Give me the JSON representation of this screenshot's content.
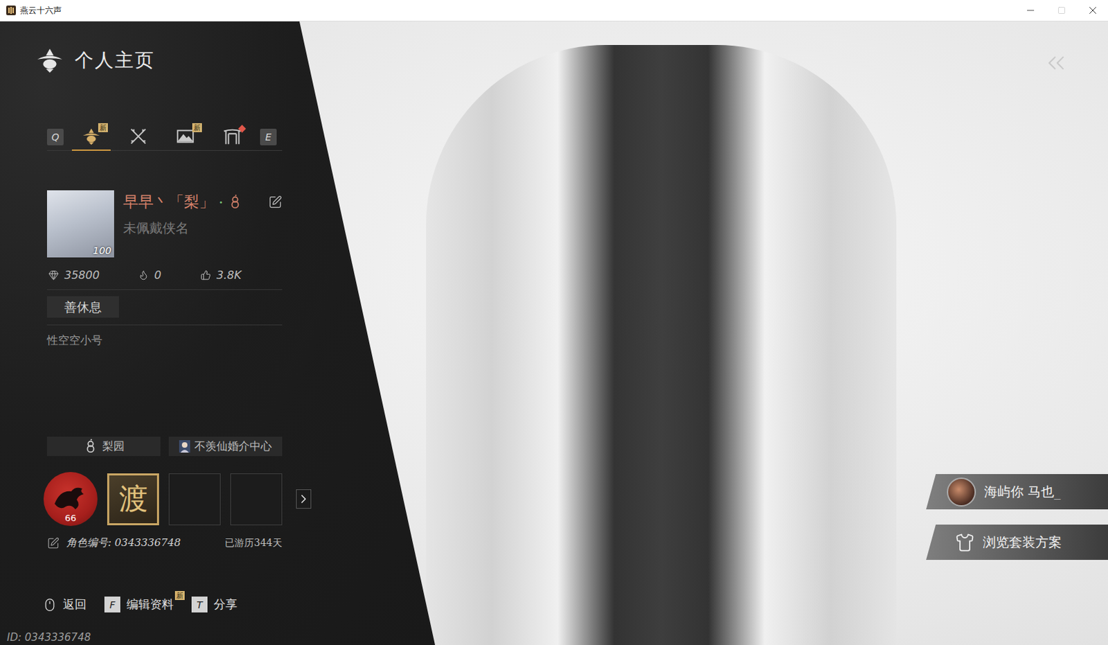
{
  "window": {
    "title": "燕云十六声"
  },
  "header": {
    "title": "个人主页"
  },
  "tab_keys": {
    "prev": "Q",
    "next": "E"
  },
  "tabs": [
    {
      "selected": true,
      "badge": "新",
      "dot": false
    },
    {
      "selected": false,
      "badge": null,
      "dot": false
    },
    {
      "selected": false,
      "badge": "新",
      "dot": false
    },
    {
      "selected": false,
      "badge": null,
      "dot": true
    }
  ],
  "profile": {
    "name": "早早丶「梨」",
    "separator": "·",
    "title": "未佩戴侠名",
    "level": "100",
    "stats": [
      {
        "value": "35800"
      },
      {
        "value": "0"
      },
      {
        "value": "3.8K"
      }
    ],
    "tag": "善休息",
    "bio": "性空空小号",
    "groups": [
      {
        "label": "梨园"
      },
      {
        "label": "不羡仙婚介中心"
      }
    ],
    "badges": [
      {
        "kind": "seal",
        "value": "66"
      },
      {
        "kind": "char",
        "value": "渡"
      },
      {
        "kind": "empty",
        "value": ""
      },
      {
        "kind": "empty",
        "value": ""
      }
    ],
    "role_id": "角色编号: 0343336748",
    "days": "已游历344天"
  },
  "footer": [
    {
      "key": "",
      "label": "返回",
      "badge": null
    },
    {
      "key": "F",
      "label": "编辑资料",
      "badge": "新"
    },
    {
      "key": "T",
      "label": "分享",
      "badge": null
    }
  ],
  "id_text": "ID: 0343336748",
  "side_buttons": [
    {
      "kind": "avatar",
      "label": "海屿你 马也_"
    },
    {
      "kind": "outfit",
      "label": "浏览套装方案"
    }
  ]
}
